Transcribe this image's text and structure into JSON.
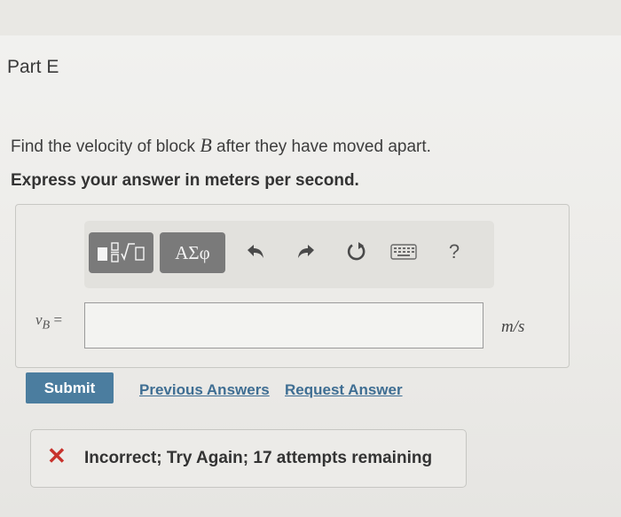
{
  "part": {
    "title": "Part E"
  },
  "question": {
    "prefix": "Find the velocity of block ",
    "variable": "B",
    "suffix": " after they have moved apart."
  },
  "instruction": "Express your answer in meters per second.",
  "toolbar": {
    "templates_icon": "templates-icon",
    "greek_label": "ΑΣφ",
    "undo_icon": "undo-icon",
    "redo_icon": "redo-icon",
    "reset_icon": "reset-icon",
    "keyboard_icon": "keyboard-icon",
    "help_label": "?"
  },
  "answer": {
    "variable_label": "v",
    "variable_sub": "B",
    "equals": " =",
    "value": "",
    "unit": "m/s"
  },
  "actions": {
    "submit_label": "Submit",
    "previous_answers_label": "Previous Answers",
    "request_answer_label": "Request Answer"
  },
  "feedback": {
    "icon": "x-icon",
    "text": "Incorrect; Try Again; 17 attempts remaining",
    "color": "#c8322c"
  }
}
